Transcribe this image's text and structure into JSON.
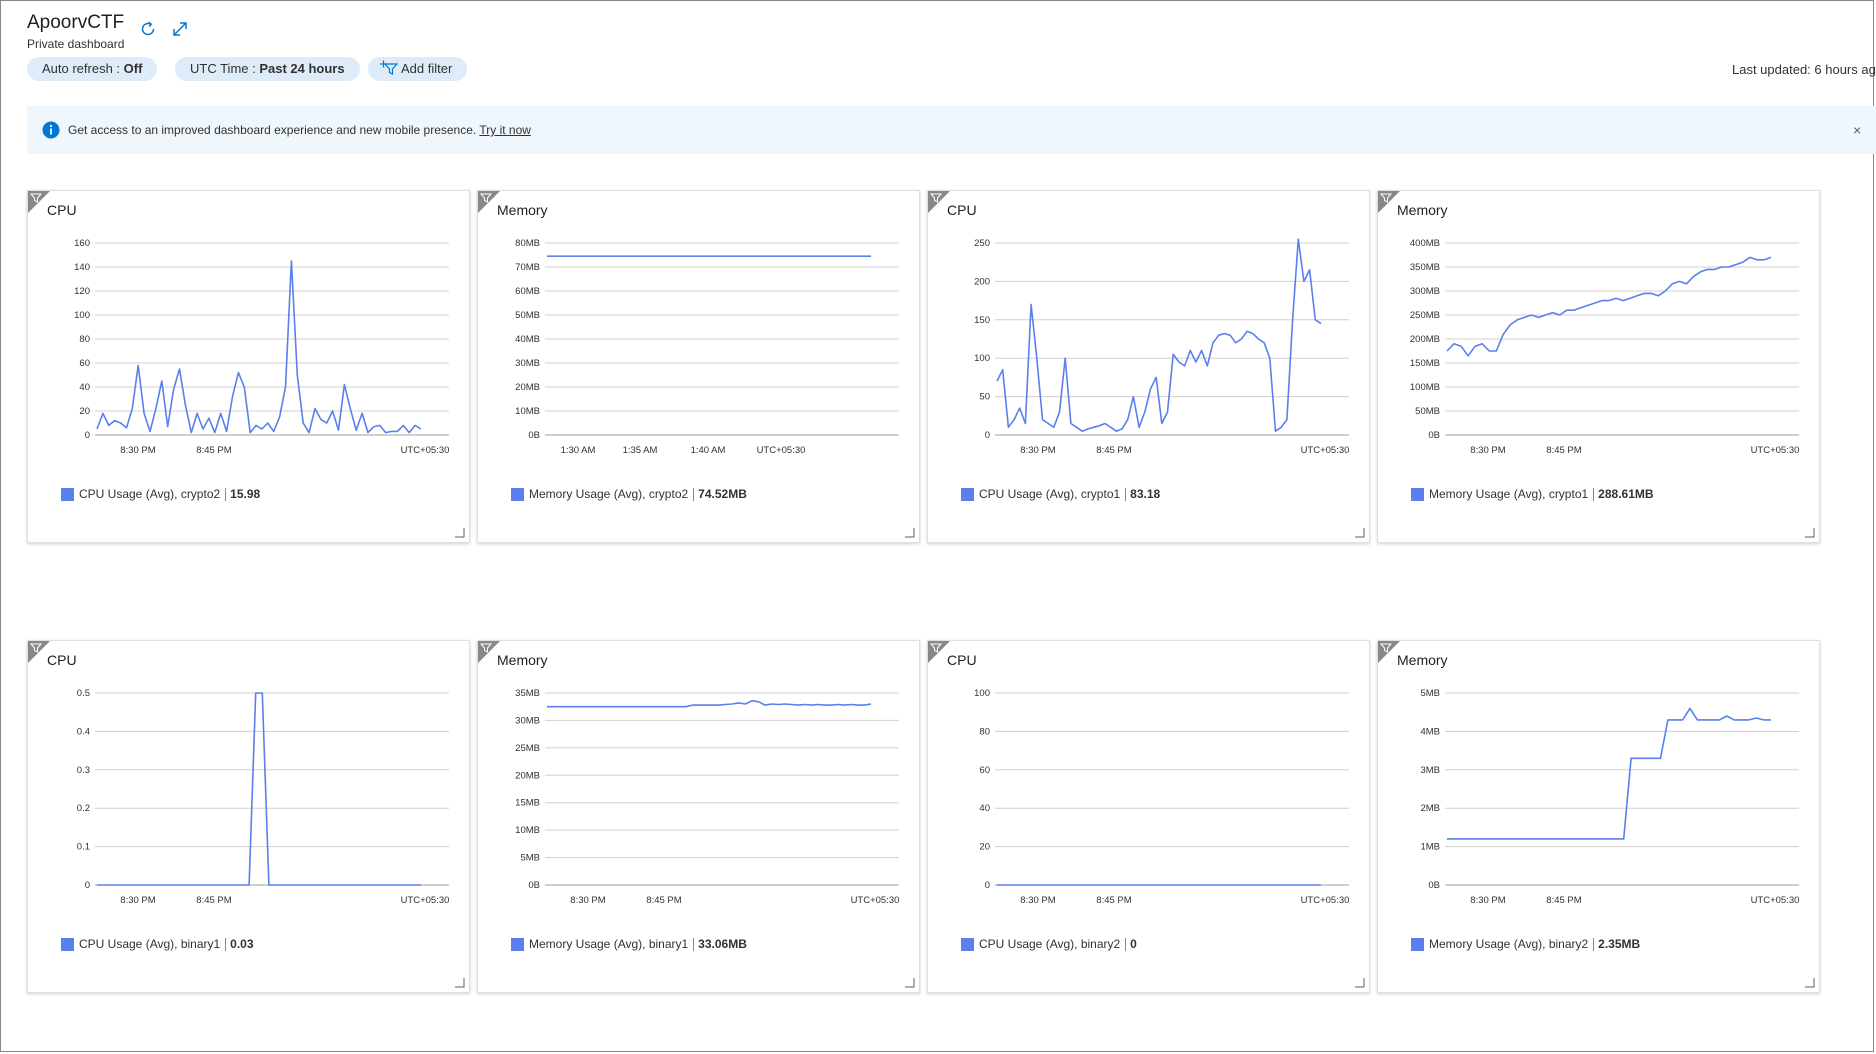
{
  "header": {
    "title": "ApoorvCTF",
    "subtitle": "Private dashboard",
    "refresh_icon": "refresh-icon",
    "fullscreen_icon": "expand-icon"
  },
  "toolbar": {
    "auto_refresh_label": "Auto refresh : ",
    "auto_refresh_value": "Off",
    "time_label": "UTC Time : ",
    "time_value": "Past 24 hours",
    "add_filter_label": "Add filter",
    "add_filter_icon": "filter-add-icon"
  },
  "last_updated": "Last updated: 6 hours ag",
  "banner": {
    "message": "Get access to an improved dashboard experience and new mobile presence. ",
    "link": "Try it now",
    "close": "×"
  },
  "colors": {
    "line": "#5b7fed",
    "pill": "#deecf9",
    "banner": "#eff6fc"
  },
  "chart_data": [
    {
      "type": "line",
      "title": "CPU",
      "x_ticks": [
        "8:30 PM",
        "8:45 PM",
        "UTC+05:30"
      ],
      "y_ticks": [
        "160",
        "140",
        "120",
        "100",
        "80",
        "60",
        "40",
        "20",
        "0"
      ],
      "ylim": [
        0,
        160
      ],
      "series": [
        {
          "name": "CPU Usage (Avg), crypto2",
          "summary": "15.98",
          "values": [
            5,
            18,
            8,
            12,
            10,
            6,
            22,
            58,
            18,
            3,
            22,
            45,
            7,
            38,
            55,
            25,
            2,
            18,
            5,
            14,
            2,
            18,
            3,
            32,
            52,
            40,
            2,
            8,
            5,
            10,
            3,
            15,
            40,
            145,
            50,
            10,
            2,
            22,
            13,
            10,
            20,
            4,
            42,
            22,
            4,
            18,
            2,
            7,
            8,
            2,
            3,
            3,
            8,
            2,
            8,
            5
          ]
        }
      ]
    },
    {
      "type": "line",
      "title": "Memory",
      "x_ticks": [
        "1:30 AM",
        "1:35 AM",
        "1:40 AM",
        "UTC+05:30"
      ],
      "y_ticks": [
        "80MB",
        "70MB",
        "60MB",
        "50MB",
        "40MB",
        "30MB",
        "20MB",
        "10MB",
        "0B"
      ],
      "ylim": [
        0,
        80
      ],
      "series": [
        {
          "name": "Memory Usage (Avg), crypto2",
          "summary": "74.52MB",
          "values": [
            74.5,
            74.5
          ]
        }
      ]
    },
    {
      "type": "line",
      "title": "CPU",
      "x_ticks": [
        "8:30 PM",
        "8:45 PM",
        "UTC+05:30"
      ],
      "y_ticks": [
        "250",
        "200",
        "150",
        "100",
        "50",
        "0"
      ],
      "ylim": [
        0,
        250
      ],
      "series": [
        {
          "name": "CPU Usage (Avg), crypto1",
          "summary": "83.18",
          "values": [
            70,
            85,
            10,
            20,
            35,
            15,
            170,
            100,
            20,
            15,
            10,
            30,
            100,
            15,
            10,
            5,
            8,
            10,
            12,
            15,
            10,
            5,
            8,
            20,
            50,
            10,
            30,
            60,
            75,
            15,
            30,
            105,
            95,
            90,
            110,
            95,
            110,
            90,
            120,
            130,
            132,
            130,
            120,
            125,
            135,
            132,
            125,
            120,
            100,
            5,
            10,
            20,
            150,
            255,
            200,
            215,
            150,
            145
          ]
        }
      ]
    },
    {
      "type": "line",
      "title": "Memory",
      "x_ticks": [
        "8:30 PM",
        "8:45 PM",
        "UTC+05:30"
      ],
      "y_ticks": [
        "400MB",
        "350MB",
        "300MB",
        "250MB",
        "200MB",
        "150MB",
        "100MB",
        "50MB",
        "0B"
      ],
      "ylim": [
        0,
        400
      ],
      "series": [
        {
          "name": "Memory Usage (Avg), crypto1",
          "summary": "288.61MB",
          "values": [
            175,
            190,
            185,
            165,
            185,
            190,
            175,
            175,
            210,
            230,
            240,
            245,
            250,
            245,
            250,
            255,
            250,
            260,
            260,
            265,
            270,
            275,
            280,
            280,
            285,
            280,
            285,
            290,
            295,
            295,
            290,
            300,
            315,
            320,
            315,
            330,
            340,
            345,
            345,
            350,
            350,
            355,
            360,
            370,
            365,
            365,
            370
          ]
        }
      ]
    },
    {
      "type": "line",
      "title": "CPU",
      "x_ticks": [
        "8:30 PM",
        "8:45 PM",
        "UTC+05:30"
      ],
      "y_ticks": [
        "0.5",
        "0.4",
        "0.3",
        "0.2",
        "0.1",
        "0"
      ],
      "ylim": [
        0,
        0.5
      ],
      "series": [
        {
          "name": "CPU Usage (Avg), binary1",
          "summary": "0.03",
          "values": [
            0,
            0,
            0,
            0,
            0,
            0,
            0,
            0,
            0,
            0,
            0,
            0,
            0,
            0,
            0,
            0,
            0,
            0,
            0,
            0,
            0,
            0,
            0,
            0,
            0.5,
            0.5,
            0,
            0,
            0,
            0,
            0,
            0,
            0,
            0,
            0,
            0,
            0,
            0,
            0,
            0,
            0,
            0,
            0,
            0,
            0,
            0,
            0,
            0,
            0,
            0
          ]
        }
      ]
    },
    {
      "type": "line",
      "title": "Memory",
      "x_ticks": [
        "8:30 PM",
        "8:45 PM",
        "UTC+05:30"
      ],
      "y_ticks": [
        "35MB",
        "30MB",
        "25MB",
        "20MB",
        "15MB",
        "10MB",
        "5MB",
        "0B"
      ],
      "ylim": [
        0,
        35
      ],
      "series": [
        {
          "name": "Memory Usage (Avg), binary1",
          "summary": "33.06MB",
          "values": [
            32.5,
            32.5,
            32.5,
            32.5,
            32.5,
            32.5,
            32.5,
            32.5,
            32.5,
            32.5,
            32.5,
            32.5,
            32.5,
            32.5,
            32.5,
            32.5,
            32.5,
            32.5,
            32.5,
            32.5,
            32.5,
            32.5,
            32.8,
            32.8,
            32.8,
            32.8,
            32.8,
            32.9,
            33.0,
            33.2,
            33.0,
            33.6,
            33.4,
            32.8,
            33.0,
            32.9,
            33.0,
            32.9,
            32.8,
            32.9,
            32.8,
            32.9,
            32.8,
            32.8,
            32.9,
            32.8,
            32.9,
            32.8,
            32.8,
            33.0
          ]
        }
      ]
    },
    {
      "type": "line",
      "title": "CPU",
      "x_ticks": [
        "8:30 PM",
        "8:45 PM",
        "UTC+05:30"
      ],
      "y_ticks": [
        "100",
        "80",
        "60",
        "40",
        "20",
        "0"
      ],
      "ylim": [
        0,
        100
      ],
      "series": [
        {
          "name": "CPU Usage (Avg), binary2",
          "summary": "0",
          "values": [
            0,
            0,
            0,
            0,
            0,
            0,
            0,
            0,
            0,
            0,
            0,
            0,
            0,
            0,
            0,
            0,
            0,
            0,
            0,
            0
          ]
        }
      ]
    },
    {
      "type": "line",
      "title": "Memory",
      "x_ticks": [
        "8:30 PM",
        "8:45 PM",
        "UTC+05:30"
      ],
      "y_ticks": [
        "5MB",
        "4MB",
        "3MB",
        "2MB",
        "1MB",
        "0B"
      ],
      "ylim": [
        0,
        5
      ],
      "series": [
        {
          "name": "Memory Usage (Avg), binary2",
          "summary": "2.35MB",
          "values": [
            1.2,
            1.2,
            1.2,
            1.2,
            1.2,
            1.2,
            1.2,
            1.2,
            1.2,
            1.2,
            1.2,
            1.2,
            1.2,
            1.2,
            1.2,
            1.2,
            1.2,
            1.2,
            1.2,
            1.2,
            1.2,
            1.2,
            1.2,
            1.2,
            1.2,
            3.3,
            3.3,
            3.3,
            3.3,
            3.3,
            4.3,
            4.3,
            4.3,
            4.6,
            4.3,
            4.3,
            4.3,
            4.3,
            4.4,
            4.3,
            4.3,
            4.3,
            4.35,
            4.3,
            4.3
          ]
        }
      ]
    }
  ]
}
